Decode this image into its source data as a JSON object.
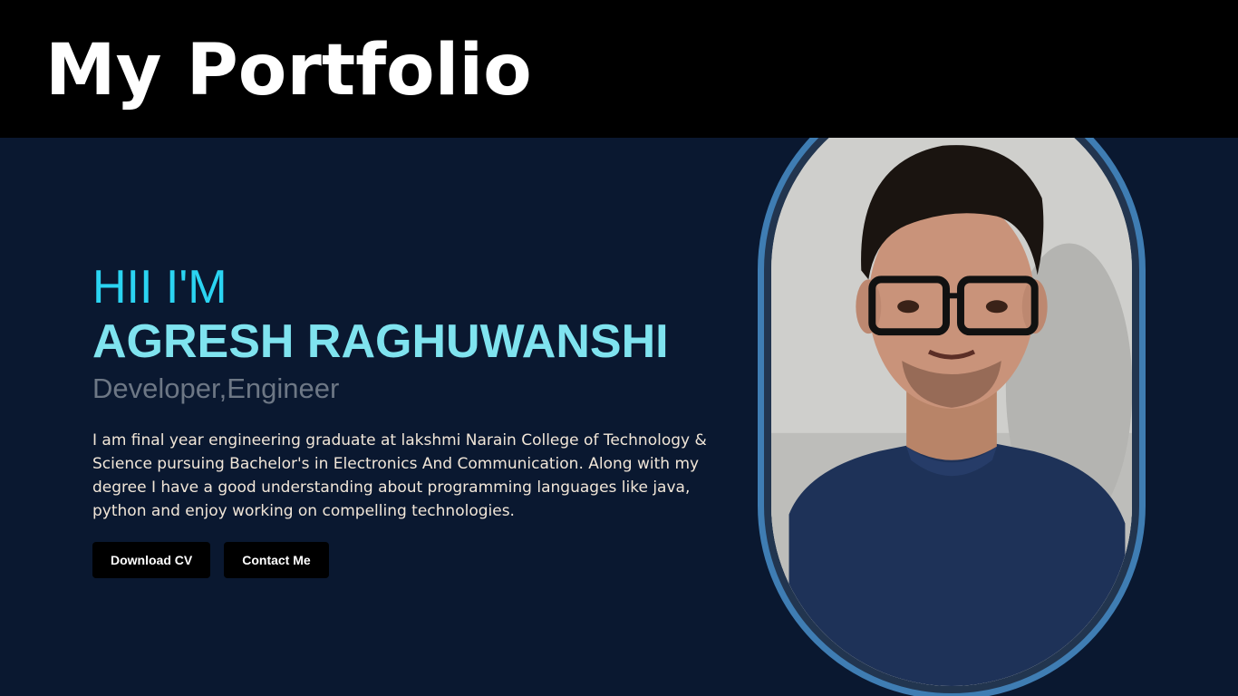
{
  "header": {
    "title": "My Portfolio"
  },
  "hero": {
    "greeting": "HII I'M",
    "name": "AGRESH RAGHUWANSHI",
    "role": "Developer,Engineer",
    "bio": "I am final year engineering graduate at lakshmi Narain College of Technology & Science pursuing Bachelor's in Electronics And Communication. Along with my degree I have a good understanding about programming languages like java, python and enjoy working on compelling technologies.",
    "buttons": {
      "download_label": "Download CV",
      "contact_label": "Contact Me"
    }
  },
  "colors": {
    "header_bg": "#000000",
    "page_bg": "#0a1830",
    "greeting": "#2bd4f2",
    "name": "#7fe3ef",
    "role": "#6d7785",
    "bio": "#f1e6d8",
    "frame": "#3f7db3"
  }
}
